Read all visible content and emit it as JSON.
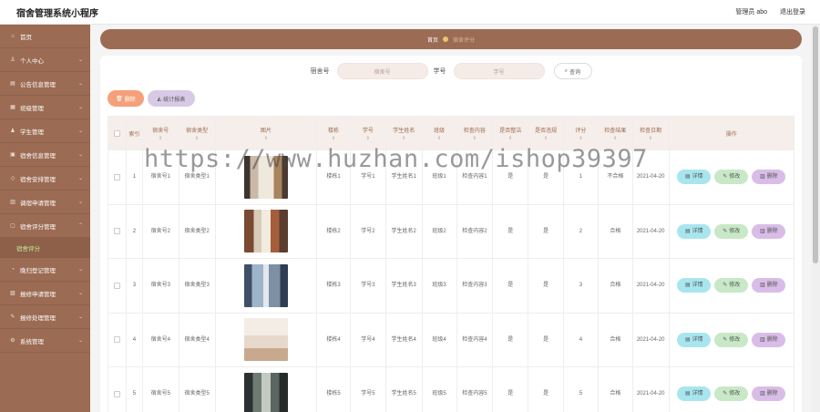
{
  "app": {
    "title": "宿舍管理系统小程序"
  },
  "header": {
    "user": "管理员 abo",
    "logout": "退出登录"
  },
  "sidebar": {
    "items": [
      {
        "label": "首页",
        "icon": "home-icon"
      },
      {
        "label": "个人中心",
        "icon": "user-icon"
      },
      {
        "label": "公告信息管理",
        "icon": "notice-icon"
      },
      {
        "label": "班级管理",
        "icon": "class-icon"
      },
      {
        "label": "学生管理",
        "icon": "student-icon"
      },
      {
        "label": "宿舍信息管理",
        "icon": "dorm-icon"
      },
      {
        "label": "宿舍安排管理",
        "icon": "arrange-icon"
      },
      {
        "label": "调宿申请管理",
        "icon": "apply-icon"
      },
      {
        "label": "宿舍评分管理",
        "icon": "score-icon"
      },
      {
        "label": "晚归登记管理",
        "icon": "late-icon"
      },
      {
        "label": "报修申请管理",
        "icon": "repair-icon"
      },
      {
        "label": "报修处理管理",
        "icon": "fix-icon"
      },
      {
        "label": "系统管理",
        "icon": "system-icon"
      }
    ],
    "active_sub": "宿舍评分"
  },
  "breadcrumb": {
    "home": "首页",
    "current": "宿舍评分"
  },
  "search": {
    "room_label": "宿舍号",
    "room_placeholder": "宿舍号",
    "sid_label": "学号",
    "sid_placeholder": "学号",
    "query_label": "查询"
  },
  "toolbar": {
    "delete_label": "删除",
    "stats_label": "统计报表"
  },
  "watermark": "https://www.huzhan.com/ishop39397",
  "table": {
    "headers": {
      "index": "索引",
      "room": "宿舍号",
      "type": "宿舍类型",
      "image": "图片",
      "building": "楼栋",
      "sid": "学号",
      "name": "学生姓名",
      "class": "班级",
      "check": "检查内容",
      "tidy": "是否整洁",
      "violation": "是否违规",
      "score": "评分",
      "result": "检查结果",
      "date": "检查日期",
      "ops": "操作"
    },
    "sort_glyph": "⇕",
    "op_labels": {
      "detail": "详情",
      "edit": "修改",
      "delete": "删除"
    },
    "rows": [
      {
        "index": "1",
        "room": "宿舍号1",
        "type": "宿舍类型1",
        "building": "楼栋1",
        "sid": "学号1",
        "name": "学生姓名1",
        "class": "班级1",
        "check": "检查内容1",
        "tidy": "是",
        "violation": "是",
        "score": "1",
        "result": "不合格",
        "date": "2021-04-20"
      },
      {
        "index": "2",
        "room": "宿舍号2",
        "type": "宿舍类型2",
        "building": "楼栋2",
        "sid": "学号2",
        "name": "学生姓名2",
        "class": "班级2",
        "check": "检查内容2",
        "tidy": "是",
        "violation": "是",
        "score": "2",
        "result": "合格",
        "date": "2021-04-20"
      },
      {
        "index": "3",
        "room": "宿舍号3",
        "type": "宿舍类型3",
        "building": "楼栋3",
        "sid": "学号3",
        "name": "学生姓名3",
        "class": "班级3",
        "check": "检查内容3",
        "tidy": "是",
        "violation": "是",
        "score": "3",
        "result": "合格",
        "date": "2021-04-20"
      },
      {
        "index": "4",
        "room": "宿舍号4",
        "type": "宿舍类型4",
        "building": "楼栋4",
        "sid": "学号4",
        "name": "学生姓名4",
        "class": "班级4",
        "check": "检查内容4",
        "tidy": "是",
        "violation": "是",
        "score": "4",
        "result": "合格",
        "date": "2021-04-20"
      },
      {
        "index": "5",
        "room": "宿舍号5",
        "type": "宿舍类型5",
        "building": "楼栋5",
        "sid": "学号5",
        "name": "学生姓名5",
        "class": "班级5",
        "check": "检查内容5",
        "tidy": "是",
        "violation": "是",
        "score": "5",
        "result": "合格",
        "date": "2021-04-20"
      }
    ]
  }
}
